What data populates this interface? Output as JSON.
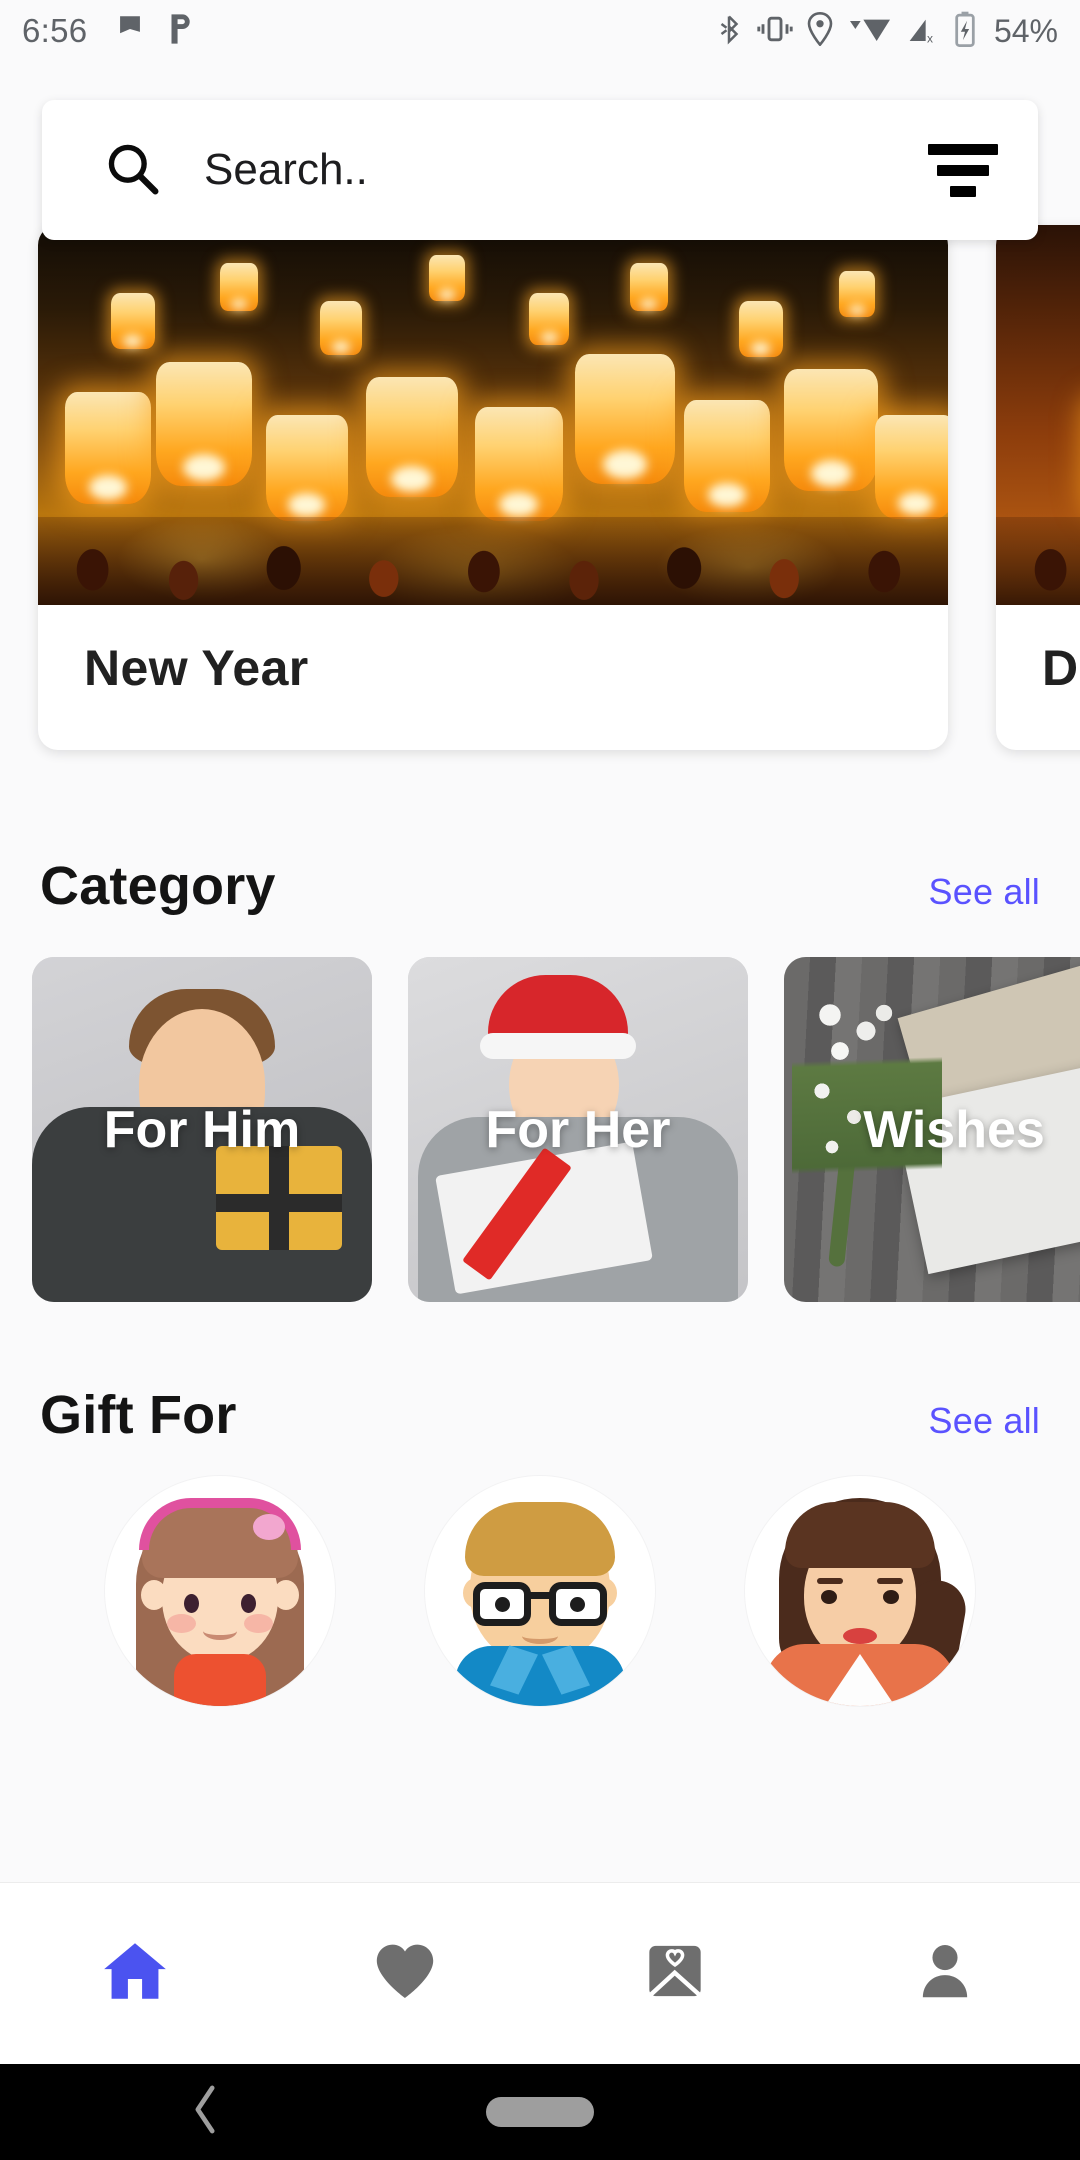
{
  "statusbar": {
    "time": "6:56",
    "battery_percent": "54%",
    "icons": [
      "flag-icon",
      "p-logo-icon",
      "bluetooth-icon",
      "vibrate-icon",
      "location-icon",
      "wifi-icon",
      "cellular-off-icon",
      "battery-charging-icon"
    ]
  },
  "search": {
    "placeholder": "Search..",
    "value": "Search..",
    "search_icon": "search-icon",
    "filter_icon": "filter-icon"
  },
  "banner": {
    "cards": [
      {
        "title": "New Year",
        "image": "sky-lanterns-festival"
      },
      {
        "title": "D",
        "image": "diwali-lamps"
      }
    ]
  },
  "category": {
    "title": "Category",
    "see_all": "See all",
    "items": [
      {
        "label": "For Him",
        "image": "man-holding-gift"
      },
      {
        "label": "For Her",
        "image": "woman-santa-hat-gift"
      },
      {
        "label": "Wishes",
        "image": "flowers-and-cards"
      }
    ]
  },
  "gift_for": {
    "title": "Gift For",
    "see_all": "See all",
    "items": [
      {
        "name": "girl-avatar"
      },
      {
        "name": "boy-avatar"
      },
      {
        "name": "woman-avatar"
      }
    ]
  },
  "bottom_nav": {
    "items": [
      {
        "icon": "home-icon",
        "active": true
      },
      {
        "icon": "heart-icon",
        "active": false
      },
      {
        "icon": "envelope-heart-icon",
        "active": false
      },
      {
        "icon": "person-icon",
        "active": false
      }
    ],
    "active_color": "#4b53f0",
    "inactive_color": "#6e6e6e"
  },
  "android_nav": {
    "back_icon": "back-chevron-icon",
    "home_pill": "home-pill"
  },
  "colors": {
    "accent": "#5a52ff",
    "background": "#fafafb",
    "card": "#ffffff",
    "text": "#141414"
  }
}
